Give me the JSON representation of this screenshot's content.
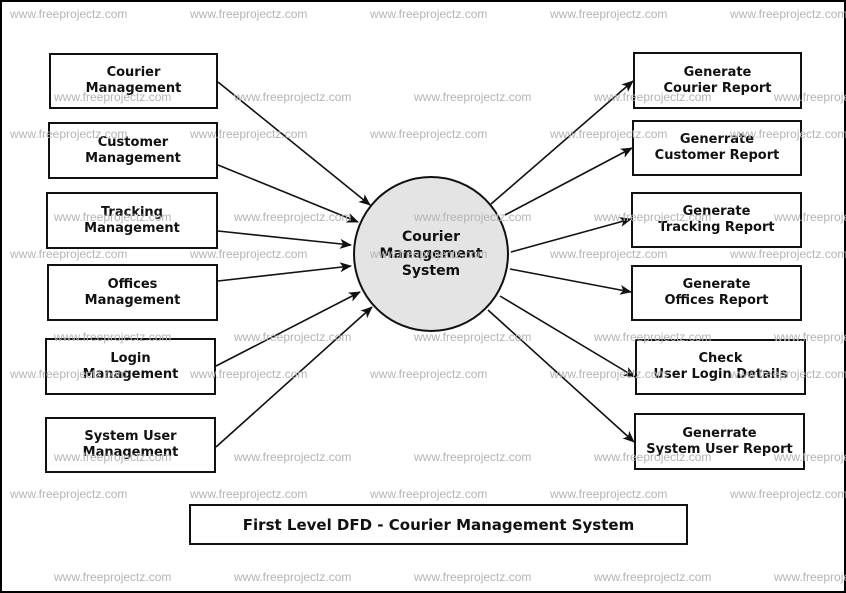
{
  "diagram": {
    "type": "data-flow-diagram",
    "title": "First Level DFD - Courier Management System",
    "process": {
      "id": "cms",
      "label": "Courier\nManagement\nSystem",
      "fill": "#e4e4e4"
    },
    "inputs": [
      {
        "id": "courier-mgmt",
        "label": "Courier\nManagement"
      },
      {
        "id": "customer-mgmt",
        "label": "Customer\nManagement"
      },
      {
        "id": "tracking-mgmt",
        "label": "Tracking\nManagement"
      },
      {
        "id": "offices-mgmt",
        "label": "Offices\nManagement"
      },
      {
        "id": "login-mgmt",
        "label": "Login\nManagement"
      },
      {
        "id": "system-user-mgmt",
        "label": "System User\nManagement"
      }
    ],
    "outputs": [
      {
        "id": "courier-report",
        "label": "Generate\nCourier Report"
      },
      {
        "id": "customer-report",
        "label": "Generrate\nCustomer Report"
      },
      {
        "id": "tracking-report",
        "label": "Generate\nTracking Report"
      },
      {
        "id": "offices-report",
        "label": "Generate\nOffices Report"
      },
      {
        "id": "user-login-details",
        "label": "Check\nUser Login Details"
      },
      {
        "id": "system-user-report",
        "label": "Generrate\nSystem User Report"
      }
    ],
    "flows": [
      {
        "from": "courier-mgmt",
        "to": "cms"
      },
      {
        "from": "customer-mgmt",
        "to": "cms"
      },
      {
        "from": "tracking-mgmt",
        "to": "cms"
      },
      {
        "from": "offices-mgmt",
        "to": "cms"
      },
      {
        "from": "login-mgmt",
        "to": "cms"
      },
      {
        "from": "system-user-mgmt",
        "to": "cms"
      },
      {
        "from": "cms",
        "to": "courier-report"
      },
      {
        "from": "cms",
        "to": "customer-report"
      },
      {
        "from": "cms",
        "to": "tracking-report"
      },
      {
        "from": "cms",
        "to": "offices-report"
      },
      {
        "from": "cms",
        "to": "user-login-details"
      },
      {
        "from": "cms",
        "to": "system-user-report"
      }
    ]
  },
  "watermark": {
    "text": "www.freeprojectz.com",
    "color": "#b4b4b4"
  }
}
